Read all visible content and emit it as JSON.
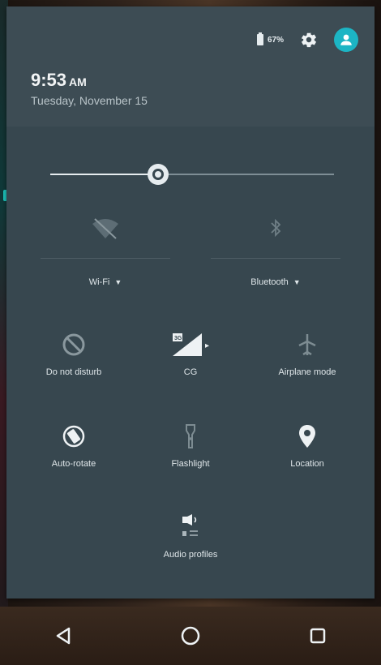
{
  "status": {
    "battery_percent": "67%"
  },
  "header": {
    "time": "9:53",
    "ampm": "AM",
    "date": "Tuesday, November 15"
  },
  "brightness": {
    "level": 0.38
  },
  "connections": [
    {
      "label": "Wi-Fi",
      "icon": "wifi-off-icon"
    },
    {
      "label": "Bluetooth",
      "icon": "bluetooth-off-icon"
    }
  ],
  "tiles": [
    {
      "label": "Do not disturb",
      "icon": "do-not-disturb-icon"
    },
    {
      "label": "CG",
      "icon": "cellular-signal-icon"
    },
    {
      "label": "Airplane mode",
      "icon": "airplane-icon"
    },
    {
      "label": "Auto-rotate",
      "icon": "auto-rotate-icon"
    },
    {
      "label": "Flashlight",
      "icon": "flashlight-icon"
    },
    {
      "label": "Location",
      "icon": "location-icon"
    },
    {
      "label": "Audio profiles",
      "icon": "audio-profile-icon"
    }
  ],
  "colors": {
    "shade": "#37474f",
    "header": "#3d4c54",
    "accent": "#1cb5c4"
  }
}
